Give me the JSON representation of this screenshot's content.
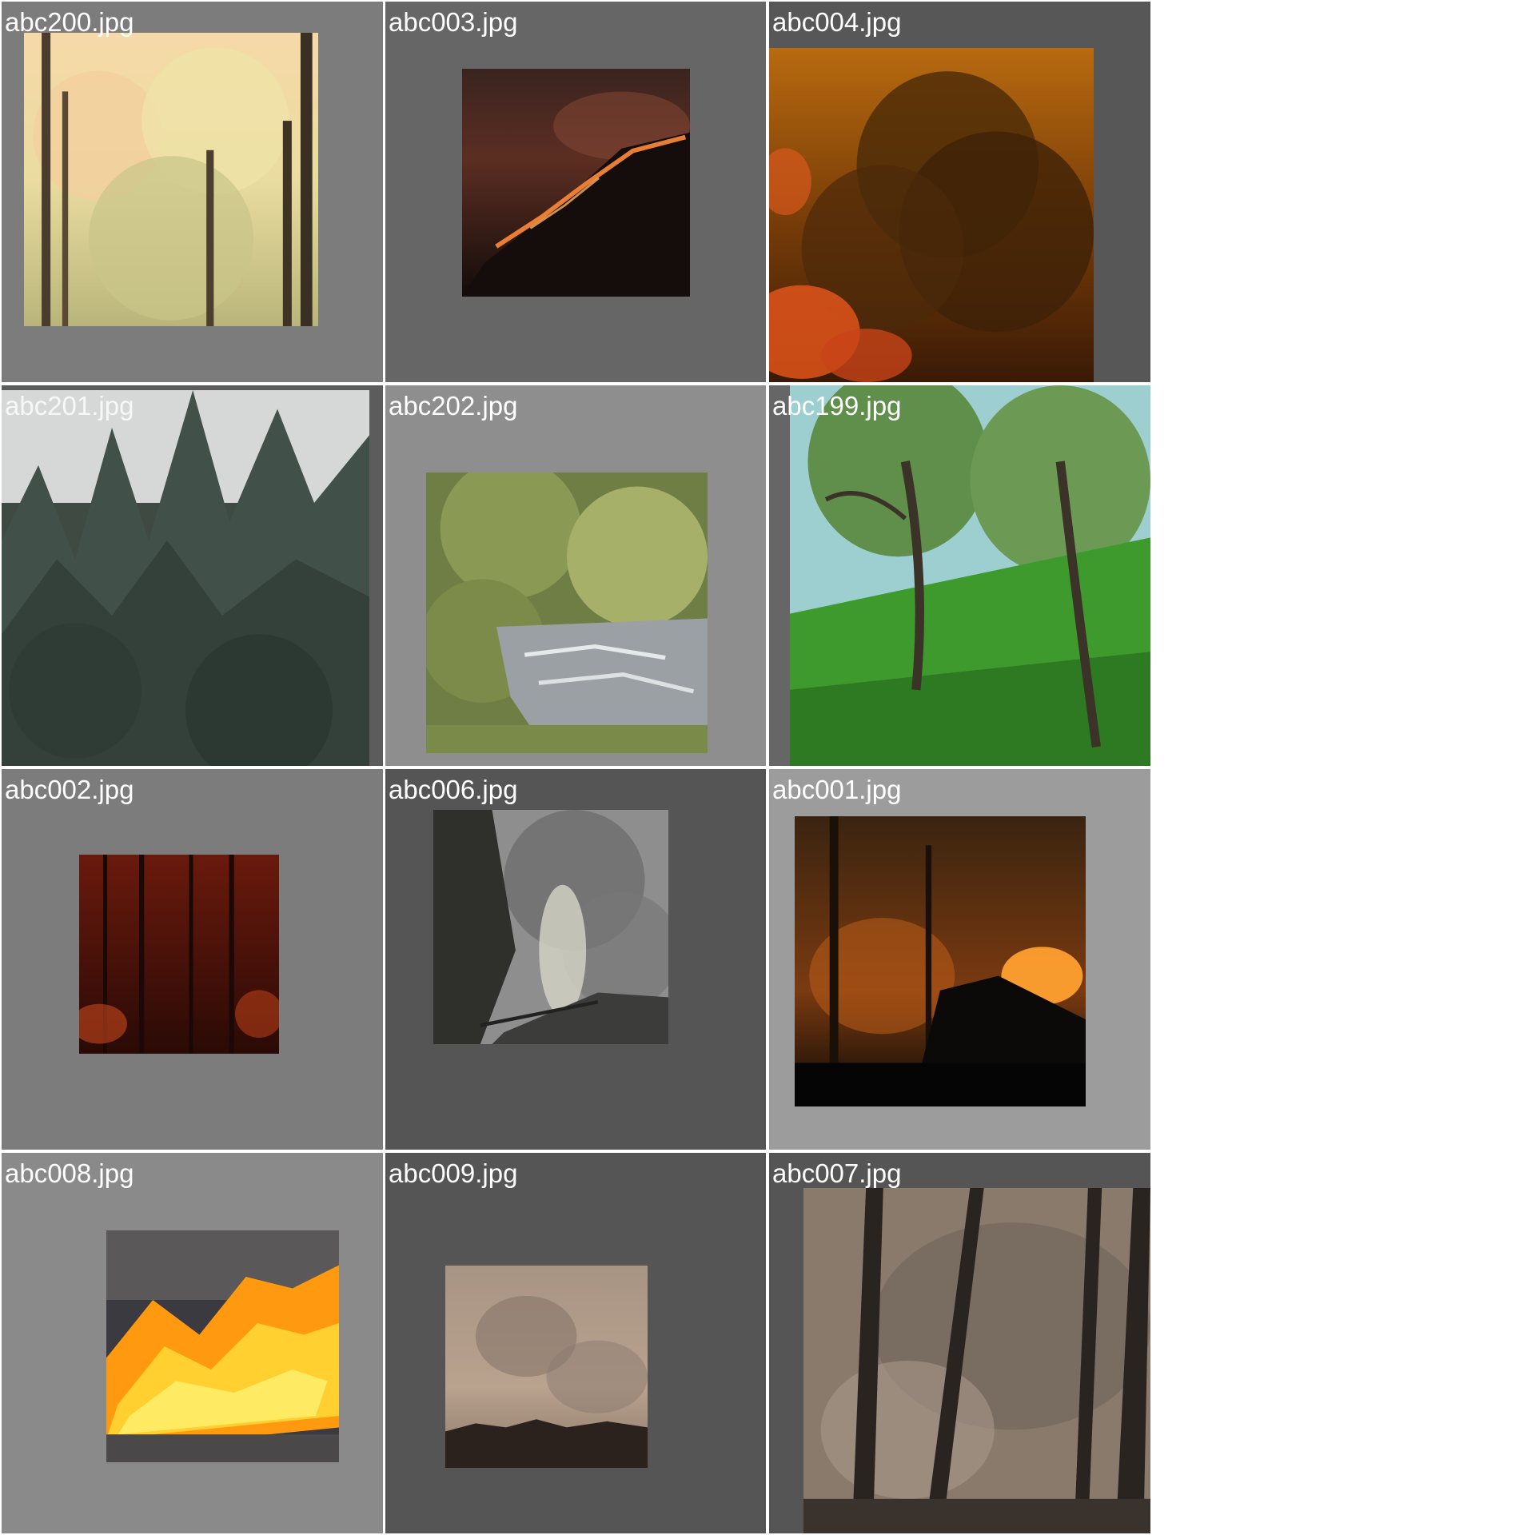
{
  "gallery": {
    "items": [
      {
        "filename": "abc200.jpg",
        "scene": "autumn-forest-photo",
        "tile_color": "#7c7c7c"
      },
      {
        "filename": "abc003.jpg",
        "scene": "night-hillside-fire-photo",
        "tile_color": "#666666"
      },
      {
        "filename": "abc004.jpg",
        "scene": "orange-smoke-forest-fire-photo",
        "tile_color": "#575757"
      },
      {
        "filename": "abc201.jpg",
        "scene": "conifer-forest-photo",
        "tile_color": "#5c5c5c"
      },
      {
        "filename": "abc202.jpg",
        "scene": "river-and-bushes-photo",
        "tile_color": "#8e8e8e"
      },
      {
        "filename": "abc199.jpg",
        "scene": "green-oak-hillside-photo",
        "tile_color": "#666666"
      },
      {
        "filename": "abc002.jpg",
        "scene": "red-night-forest-fire-photo",
        "tile_color": "#7c7c7c"
      },
      {
        "filename": "abc006.jpg",
        "scene": "smoke-over-road-photo",
        "tile_color": "#555555"
      },
      {
        "filename": "abc001.jpg",
        "scene": "glowing-forest-fire-photo",
        "tile_color": "#9c9c9c"
      },
      {
        "filename": "abc008.jpg",
        "scene": "roadside-flames-photo",
        "tile_color": "#8a8a8a"
      },
      {
        "filename": "abc009.jpg",
        "scene": "smoky-sky-photo",
        "tile_color": "#555555"
      },
      {
        "filename": "abc007.jpg",
        "scene": "smoky-pine-trunks-photo",
        "tile_color": "#555555"
      }
    ]
  }
}
